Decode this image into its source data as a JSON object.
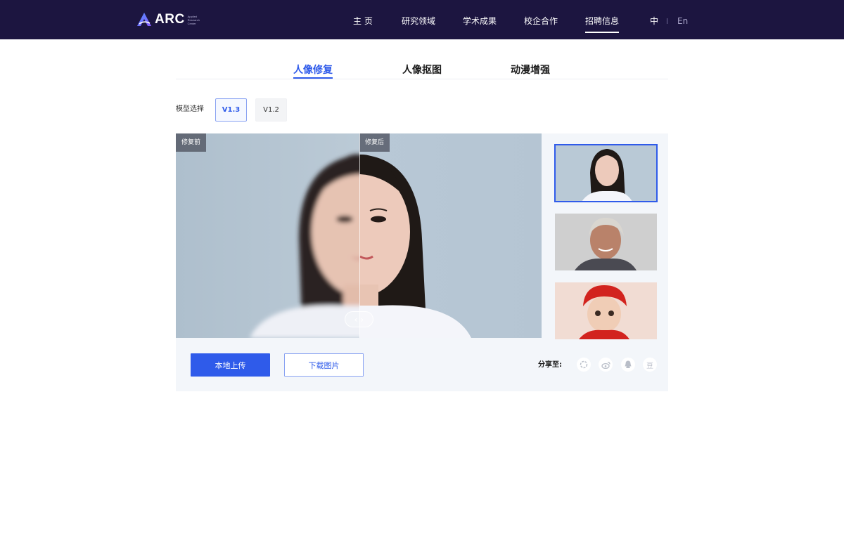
{
  "header": {
    "logo_text": "ARC",
    "logo_subtext": "Applied Research Center",
    "nav": [
      {
        "label": "主 页"
      },
      {
        "label": "研究领域"
      },
      {
        "label": "学术成果"
      },
      {
        "label": "校企合作"
      },
      {
        "label": "招聘信息"
      }
    ],
    "active_nav": "招聘信息",
    "lang_zh": "中",
    "lang_en": "En",
    "background_color": "#1c1540"
  },
  "tabs": [
    {
      "label": "人像修复"
    },
    {
      "label": "人像抠图"
    },
    {
      "label": "动漫增强"
    }
  ],
  "active_tab": "人像修复",
  "model": {
    "label": "模型选择",
    "options": [
      "V1.3",
      "V1.2"
    ],
    "selected": "V1.3"
  },
  "viewer": {
    "before_label": "修复前",
    "after_label": "修复后",
    "slider_icon": "chevron-left-right-icon"
  },
  "samples": [
    {
      "name": "young-woman-portrait",
      "selected": true
    },
    {
      "name": "older-man-portrait",
      "selected": false
    },
    {
      "name": "child-red-hat-portrait",
      "selected": false
    }
  ],
  "actions": {
    "upload_label": "本地上传",
    "download_label": "下载图片"
  },
  "share": {
    "label": "分享至:",
    "icons": [
      "moments-icon",
      "weibo-icon",
      "qq-icon",
      "douban-icon"
    ],
    "douban_glyph": "豆"
  },
  "colors": {
    "accent": "#2f5bea",
    "panel_bg": "#f3f6fa"
  }
}
